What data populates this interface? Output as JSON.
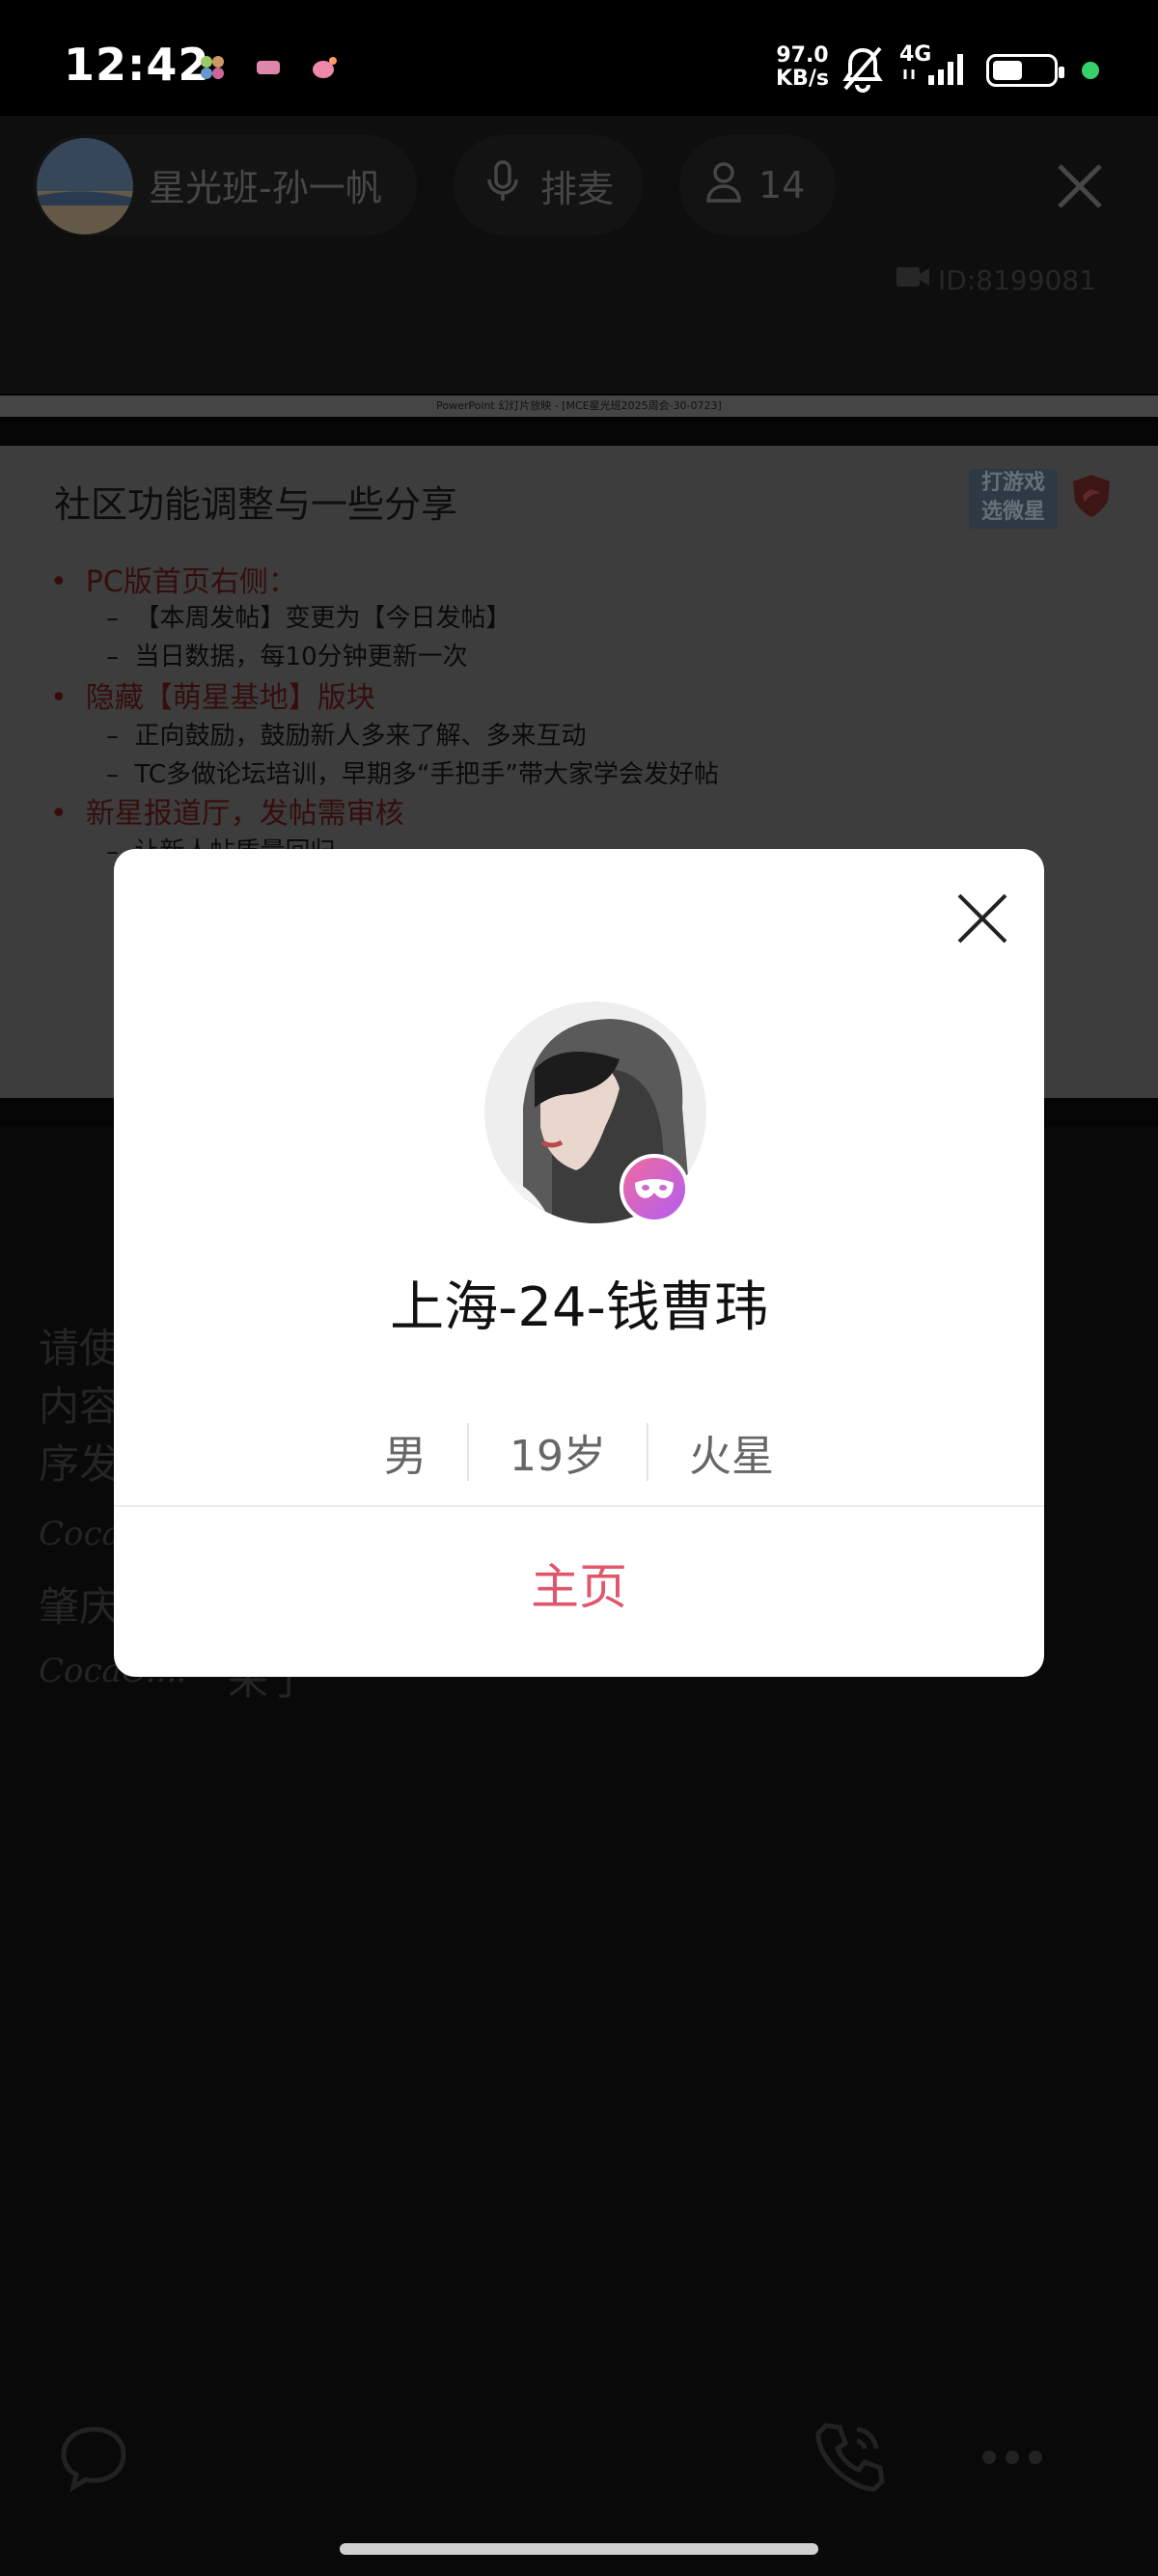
{
  "status_bar": {
    "time": "12:42",
    "net_speed_value": "97.0",
    "net_speed_unit": "KB/s",
    "network": "4G",
    "notif_icons": [
      "app-icon-1",
      "app-icon-2",
      "weibo-icon"
    ]
  },
  "room": {
    "name": "星光班-孙一帆",
    "queue_label": "排麦",
    "listener_count": "14",
    "room_id": "ID:8199081"
  },
  "slide": {
    "window_title": "PowerPoint 幻灯片放映 - [MCE星光班2025周会-30-0723]",
    "title": "社区功能调整与一些分享",
    "logo_text_1": "打游戏",
    "logo_text_2": "选微星",
    "bullets": [
      {
        "text": "PC版首页右侧：",
        "subs": [
          "【本周发帖】变更为【今日发帖】",
          "当日数据，每10分钟更新一次"
        ]
      },
      {
        "text": "隐藏【萌星基地】版块",
        "subs": [
          "正向鼓励，鼓励新人多来了解、多来互动",
          "TC多做论坛培训，早期多“手把手”带大家学会发好帖"
        ]
      },
      {
        "text": "新星报道厅，发帖需审核",
        "subs": [
          "让新人帖质量回归"
        ]
      }
    ]
  },
  "chat": {
    "lines": [
      "请使",
      "内容",
      "序发"
    ],
    "coca_1": "Coca",
    "line_4": "肇庆",
    "coca_2": "CocaC...:",
    "coca_2_msg": "来了"
  },
  "profile_card": {
    "name": "上海-24-钱曹玮",
    "gender": "男",
    "age": "19岁",
    "sign": "火星",
    "home_button": "主页"
  },
  "colors": {
    "accent_pink": "#e0566d",
    "badge_gradient_start": "#f06aa0",
    "badge_gradient_end": "#b35ef0",
    "status_green": "#36d16a"
  }
}
